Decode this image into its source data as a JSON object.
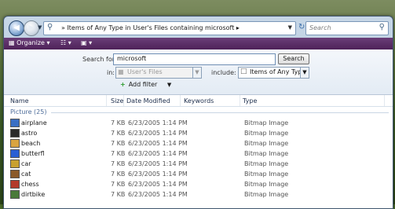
{
  "address": {
    "path_text": "Items of Any Type in User's Files containing microsoft",
    "search_placeholder": "Search"
  },
  "toolbar": {
    "organize_label": "Organize"
  },
  "search_pane": {
    "search_for_label": "Search for:",
    "query_value": "microsoft",
    "search_button": "Search",
    "in_label": "in:",
    "location_value": "User's Files",
    "include_label": "include:",
    "include_value": "Items of Any Type",
    "add_filter_label": "Add filter"
  },
  "columns": {
    "name": "Name",
    "size": "Size",
    "date_modified": "Date Modified",
    "keywords": "Keywords",
    "type": "Type"
  },
  "group_header": "Picture (25)",
  "files": [
    {
      "name": "airplane",
      "size": "7 KB",
      "date": "6/23/2005 1:14 PM",
      "type": "Bitmap Image",
      "color": "#3a6fc4"
    },
    {
      "name": "astro",
      "size": "7 KB",
      "date": "6/23/2005 1:14 PM",
      "type": "Bitmap Image",
      "color": "#2a2a2a"
    },
    {
      "name": "beach",
      "size": "7 KB",
      "date": "6/23/2005 1:14 PM",
      "type": "Bitmap Image",
      "color": "#d9a441"
    },
    {
      "name": "butterfl",
      "size": "7 KB",
      "date": "6/23/2005 1:14 PM",
      "type": "Bitmap Image",
      "color": "#2a5fd4"
    },
    {
      "name": "car",
      "size": "7 KB",
      "date": "6/23/2005 1:14 PM",
      "type": "Bitmap Image",
      "color": "#c8a030"
    },
    {
      "name": "cat",
      "size": "7 KB",
      "date": "6/23/2005 1:14 PM",
      "type": "Bitmap Image",
      "color": "#8a5a2a"
    },
    {
      "name": "chess",
      "size": "7 KB",
      "date": "6/23/2005 1:14 PM",
      "type": "Bitmap Image",
      "color": "#b33a2a"
    },
    {
      "name": "dirtbike",
      "size": "7 KB",
      "date": "6/23/2005 1:14 PM",
      "type": "Bitmap Image",
      "color": "#4a7a3a"
    }
  ]
}
